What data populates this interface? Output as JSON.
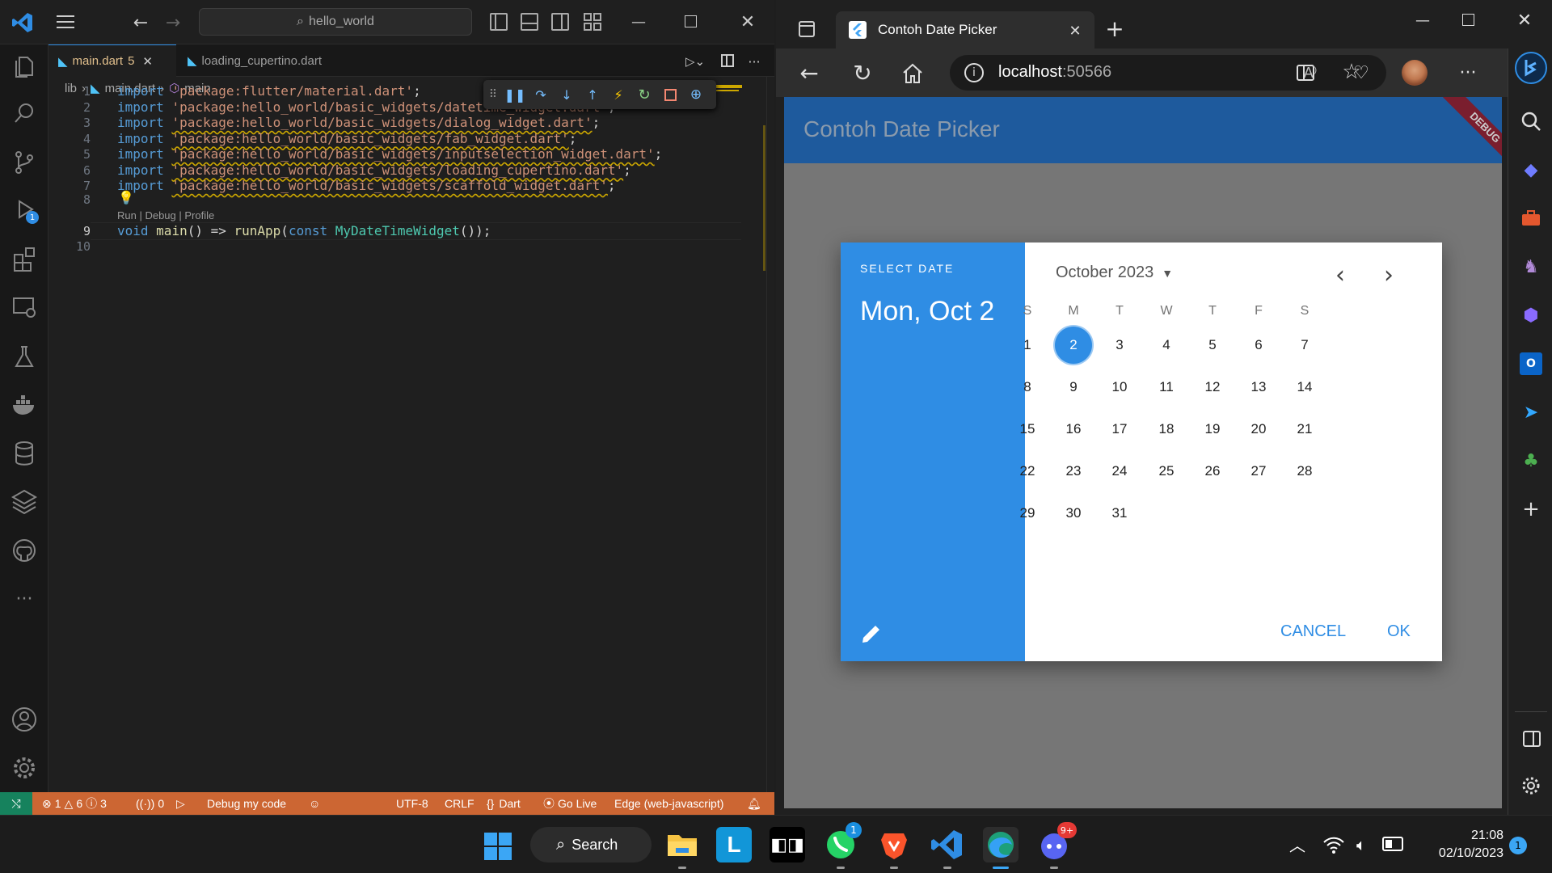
{
  "vscode": {
    "command_center": "hello_world",
    "tabs": [
      {
        "label": "main.dart",
        "badge": "5"
      },
      {
        "label": "loading_cupertino.dart"
      }
    ],
    "breadcrumb": {
      "folder": "lib",
      "file": "main.dart",
      "symbol": "main"
    },
    "code_lines": [
      {
        "n": "1",
        "kw": "import",
        "str": "'package:flutter/material.dart'",
        "end": ";"
      },
      {
        "n": "2",
        "kw": "import",
        "str": "'package:hello_world/basic_widgets/datetime_widget.dart'",
        "end": ";"
      },
      {
        "n": "3",
        "kw": "import",
        "str": "'package:hello_world/basic_widgets/dialog_widget.dart'",
        "end": ";"
      },
      {
        "n": "4",
        "kw": "import",
        "str": "'package:hello_world/basic_widgets/fab_widget.dart'",
        "end": ";"
      },
      {
        "n": "5",
        "kw": "import",
        "str": "'package:hello_world/basic_widgets/inputselection_widget.dart'",
        "end": ";"
      },
      {
        "n": "6",
        "kw": "import",
        "str": "'package:hello_world/basic_widgets/loading_cupertino.dart'",
        "end": ";"
      },
      {
        "n": "7",
        "kw": "import",
        "str": "'package:hello_world/basic_widgets/scaffold_widget.dart'",
        "end": ";"
      }
    ],
    "line8": "8",
    "codelens": "Run | Debug | Profile",
    "line9": {
      "n": "9",
      "kw1": "void",
      "fn1": "main",
      "p1": "() => ",
      "fn2": "runApp",
      "p2": "(",
      "kw2": "const",
      "cls": "MyDateTimeWidget",
      "p3": "());"
    },
    "line10": "10",
    "status": {
      "errors": "1",
      "warnings": "6",
      "infos": "3",
      "ports": "0",
      "debug": "Debug my code",
      "encoding": "UTF-8",
      "eol": "CRLF",
      "language": "Dart",
      "golive": "Go Live",
      "device": "Edge (web-javascript)"
    }
  },
  "edge": {
    "tab_title": "Contoh Date Picker",
    "url_host": "localhost",
    "url_port": ":50566"
  },
  "app": {
    "appbar_title": "Contoh Date Picker",
    "debug_banner": "DEBUG",
    "dialog": {
      "header_label": "SELECT DATE",
      "selected_date": "Mon, Oct 2",
      "month_year": "October 2023",
      "weekdays": [
        "S",
        "M",
        "T",
        "W",
        "T",
        "F",
        "S"
      ],
      "first_day_offset": 0,
      "days": [
        "1",
        "2",
        "3",
        "4",
        "5",
        "6",
        "7",
        "8",
        "9",
        "10",
        "11",
        "12",
        "13",
        "14",
        "15",
        "16",
        "17",
        "18",
        "19",
        "20",
        "21",
        "22",
        "23",
        "24",
        "25",
        "26",
        "27",
        "28",
        "29",
        "30",
        "31"
      ],
      "selected_day": "2",
      "cancel": "CANCEL",
      "ok": "OK"
    }
  },
  "taskbar": {
    "search": "Search",
    "whatsapp_badge": "1",
    "discord_badge": "9+",
    "time": "21:08",
    "date": "02/10/2023",
    "notification_count": "1"
  },
  "colors": {
    "accent_blue": "#2f8de4",
    "appbar": "#1e5a9d",
    "status_bar": "#cc6633"
  }
}
